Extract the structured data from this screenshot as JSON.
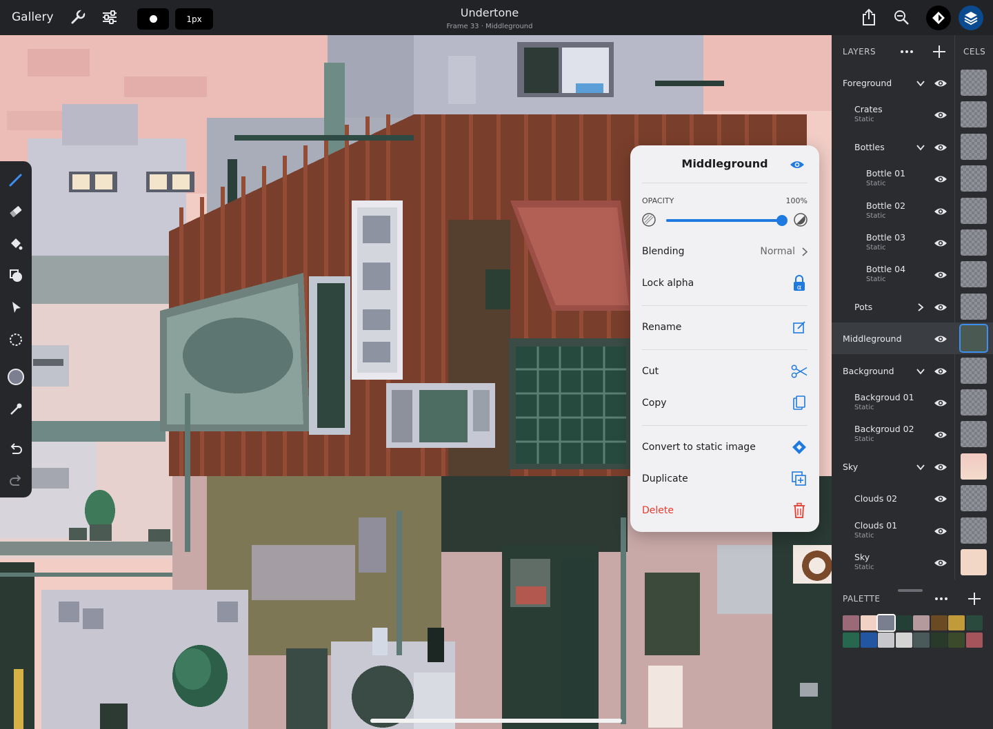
{
  "topbar": {
    "gallery_label": "Gallery",
    "brush_size_label": "1px",
    "title": "Undertone",
    "subtitle": "Frame 33 · Middleground",
    "icons": [
      "wrench-icon",
      "adjustments-icon",
      "brush-dot-icon",
      "share-icon",
      "zoom-icon",
      "reference-icon",
      "layers-icon"
    ]
  },
  "toolbar": {
    "tools": [
      "pencil-icon",
      "eraser-icon",
      "fill-bucket-icon",
      "shapes-icon",
      "move-icon",
      "selection-icon",
      "color-picker-icon",
      "eyedropper-icon",
      "undo-icon",
      "redo-icon"
    ]
  },
  "popover": {
    "title": "Middleground",
    "opacity_label": "OPACITY",
    "opacity_value": "100%",
    "opacity_fraction": 1.0,
    "blending_label": "Blending",
    "blending_value": "Normal",
    "lock_alpha_label": "Lock alpha",
    "rename_label": "Rename",
    "cut_label": "Cut",
    "copy_label": "Copy",
    "convert_label": "Convert to static image",
    "duplicate_label": "Duplicate",
    "delete_label": "Delete",
    "accent_color": "#1f7ae0",
    "delete_color": "#e8392c"
  },
  "panel": {
    "layers_label": "LAYERS",
    "cels_label": "CELS",
    "palette_label": "PALETTE",
    "layers": [
      {
        "name": "Foreground",
        "sub": "",
        "level": 0,
        "chevron": "down",
        "selected": false,
        "cel": "fg"
      },
      {
        "name": "Crates",
        "sub": "Static",
        "level": 1,
        "chevron": "",
        "selected": false,
        "cel": "crates"
      },
      {
        "name": "Bottles",
        "sub": "",
        "level": 1,
        "chevron": "down",
        "selected": false,
        "cel": "empty"
      },
      {
        "name": "Bottle 01",
        "sub": "Static",
        "level": 2,
        "chevron": "",
        "selected": false,
        "cel": "b1"
      },
      {
        "name": "Bottle 02",
        "sub": "Static",
        "level": 2,
        "chevron": "",
        "selected": false,
        "cel": "b2"
      },
      {
        "name": "Bottle 03",
        "sub": "Static",
        "level": 2,
        "chevron": "",
        "selected": false,
        "cel": "b3"
      },
      {
        "name": "Bottle 04",
        "sub": "Static",
        "level": 2,
        "chevron": "",
        "selected": false,
        "cel": "b4"
      },
      {
        "name": "Pots",
        "sub": "",
        "level": 1,
        "chevron": "right",
        "selected": false,
        "cel": "pots"
      },
      {
        "name": "Middleground",
        "sub": "",
        "level": 0,
        "chevron": "",
        "selected": true,
        "cel": "mid"
      },
      {
        "name": "Background",
        "sub": "",
        "level": 0,
        "chevron": "down",
        "selected": false,
        "cel": "bg"
      },
      {
        "name": "Backgroud 01",
        "sub": "Static",
        "level": 1,
        "chevron": "",
        "selected": false,
        "cel": "bg1"
      },
      {
        "name": "Backgroud 02",
        "sub": "Static",
        "level": 1,
        "chevron": "",
        "selected": false,
        "cel": "bg2"
      },
      {
        "name": "Sky",
        "sub": "",
        "level": 0,
        "chevron": "down",
        "selected": false,
        "cel": "skyg"
      },
      {
        "name": "Clouds 02",
        "sub": "",
        "level": 1,
        "chevron": "",
        "selected": false,
        "cel": "c2"
      },
      {
        "name": "Clouds 01",
        "sub": "Static",
        "level": 1,
        "chevron": "",
        "selected": false,
        "cel": "c1"
      },
      {
        "name": "Sky",
        "sub": "Static",
        "level": 1,
        "chevron": "",
        "selected": false,
        "cel": "sky"
      }
    ],
    "palette": [
      "#9a6a78",
      "#f2d2c4",
      "#7a7f8f",
      "#233f36",
      "#b49a9c",
      "#6a4a22",
      "#c19a3a",
      "#2a4a3e",
      "#27664f",
      "#2256a0",
      "#c8c8cc",
      "#d4d4d4",
      "#4a5a5a",
      "#2a3a2a",
      "#3a4a2a",
      "#a4545a"
    ],
    "selected_swatch": 2
  }
}
